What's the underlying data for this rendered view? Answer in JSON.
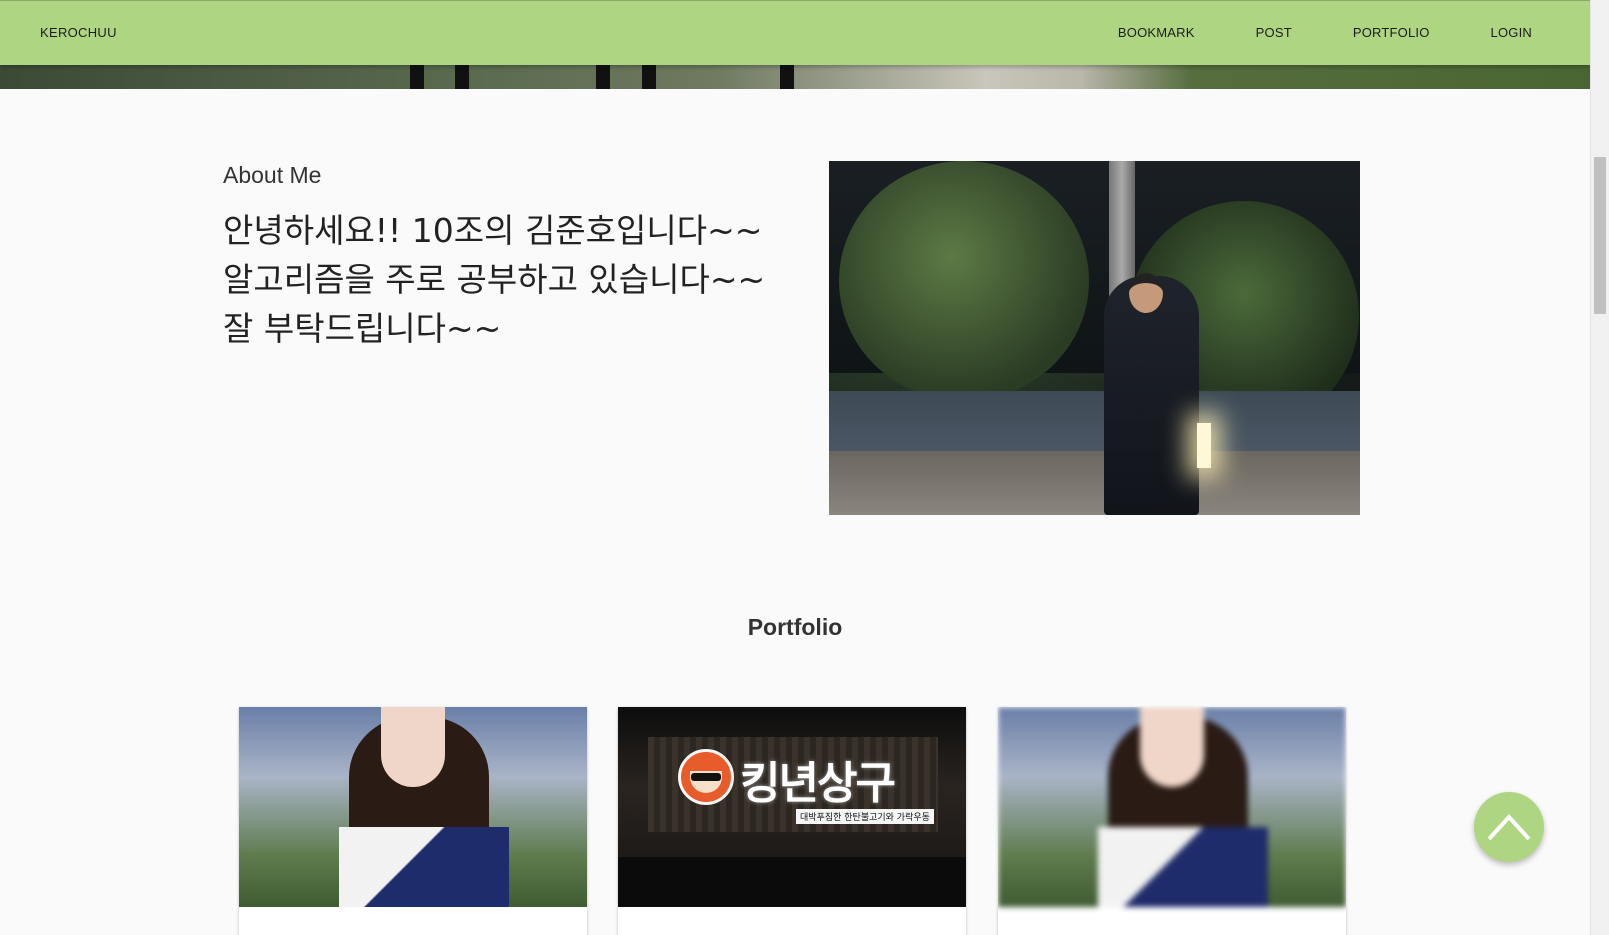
{
  "navbar": {
    "brand": "KEROCHUU",
    "links": [
      "BOOKMARK",
      "POST",
      "PORTFOLIO",
      "LOGIN"
    ]
  },
  "about": {
    "heading": "About Me",
    "lines": [
      "안녕하세요!! 10조의 김준호입니다~~",
      "알고리즘을 주로 공부하고 있습니다~~",
      "잘 부탁드립니다~~"
    ]
  },
  "portfolio": {
    "heading": "Portfolio",
    "cards": [
      {
        "image": "stadium-portrait-photo"
      },
      {
        "image": "restaurant-sign-photo",
        "sign_title": "킹년상구",
        "sign_sub": "대박푸짐한 한탄불고기와 가락우동"
      },
      {
        "image": "stadium-portrait-photo-blurred"
      }
    ]
  },
  "fab": {
    "icon": "chevron-up-icon"
  },
  "colors": {
    "accent": "#aed581"
  }
}
